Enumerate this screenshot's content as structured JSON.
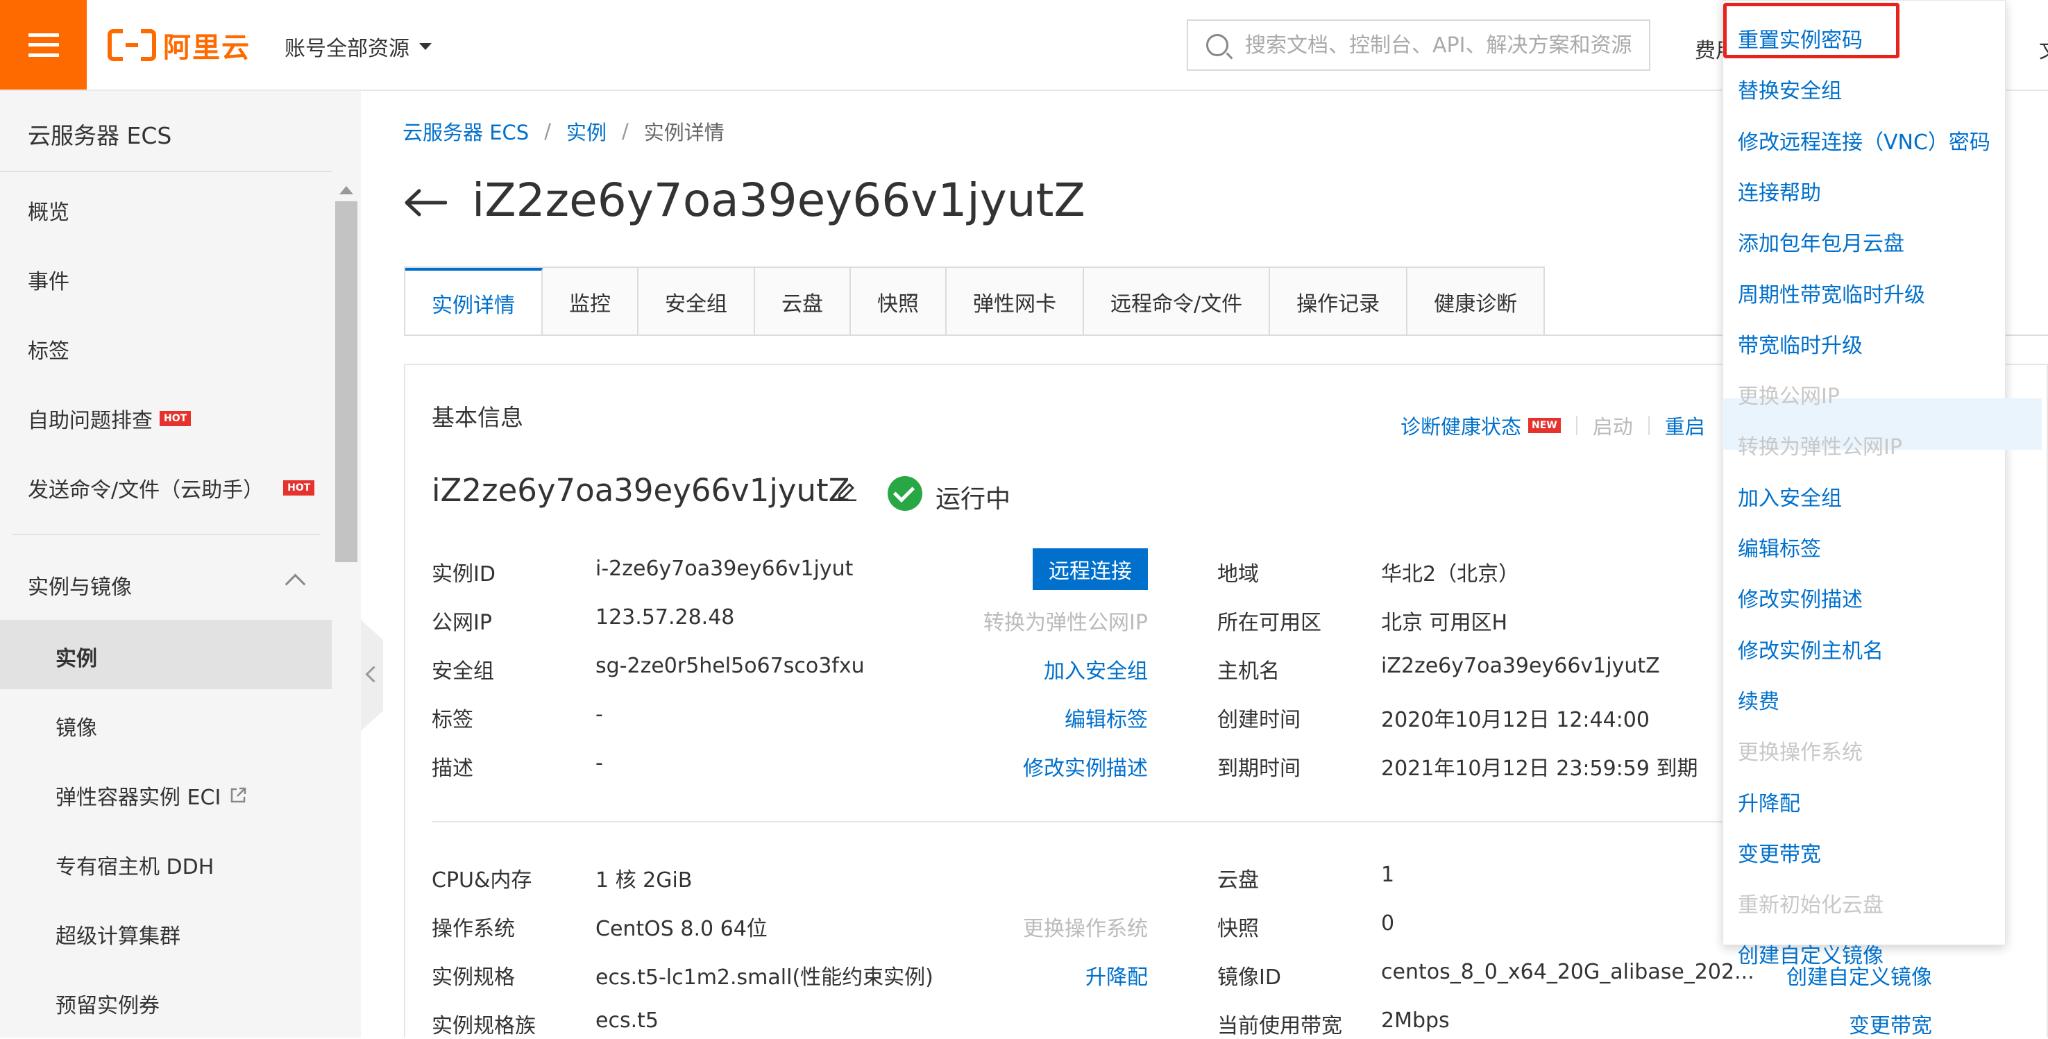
{
  "topbar": {
    "logo_text": "阿里云",
    "account_label": "账号全部资源",
    "search_placeholder": "搜索文档、控制台、API、解决方案和资源",
    "fee_label": "费用",
    "right_clip": "文"
  },
  "sidebar": {
    "title": "云服务器 ECS",
    "items": [
      {
        "label": "概览"
      },
      {
        "label": "事件"
      },
      {
        "label": "标签"
      },
      {
        "label": "自助问题排查",
        "badge": "HOT"
      },
      {
        "label": "发送命令/文件（云助手）",
        "badge": "HOT"
      }
    ],
    "group": {
      "label": "实例与镜像"
    },
    "sub_items": [
      {
        "label": "实例"
      },
      {
        "label": "镜像"
      },
      {
        "label": "弹性容器实例 ECI"
      },
      {
        "label": "专有宿主机 DDH"
      },
      {
        "label": "超级计算集群"
      },
      {
        "label": "预留实例券"
      }
    ]
  },
  "breadcrumb": {
    "items": [
      "云服务器 ECS",
      "实例",
      "实例详情"
    ],
    "sep": "/"
  },
  "page": {
    "title": "iZ2ze6y7oa39ey66v1jyutZ"
  },
  "tabs": [
    "实例详情",
    "监控",
    "安全组",
    "云盘",
    "快照",
    "弹性网卡",
    "远程命令/文件",
    "操作记录",
    "健康诊断"
  ],
  "panel": {
    "title": "基本信息",
    "actions": {
      "diagnose": "诊断健康状态",
      "new_badge": "NEW",
      "start": "启动",
      "restart": "重启"
    },
    "instance_name": "iZ2ze6y7oa39ey66v1jyutZ",
    "status": "运行中",
    "remote_button": "远程连接",
    "rows_left": [
      {
        "label": "实例ID",
        "value": "i-2ze6y7oa39ey66v1jyut",
        "action": ""
      },
      {
        "label": "公网IP",
        "value": "123.57.28.48",
        "action": "转换为弹性公网IP"
      },
      {
        "label": "安全组",
        "value": "sg-2ze0r5hel5o67sco3fxu",
        "action": "加入安全组"
      },
      {
        "label": "标签",
        "value": "-",
        "action": "编辑标签"
      },
      {
        "label": "描述",
        "value": "-",
        "action": "修改实例描述"
      }
    ],
    "rows_right": [
      {
        "label": "地域",
        "value": "华北2（北京）"
      },
      {
        "label": "所在可用区",
        "value": "北京 可用区H"
      },
      {
        "label": "主机名",
        "value": "iZ2ze6y7oa39ey66v1jyutZ"
      },
      {
        "label": "创建时间",
        "value": "2020年10月12日 12:44:00"
      },
      {
        "label": "到期时间",
        "value": "2021年10月12日 23:59:59 到期"
      }
    ],
    "spec_left": [
      {
        "label": "CPU&内存",
        "value": "1 核 2GiB",
        "action": ""
      },
      {
        "label": "操作系统",
        "value": "CentOS 8.0 64位",
        "action": "更换操作系统"
      },
      {
        "label": "实例规格",
        "value": "ecs.t5-lc1m2.small(性能约束实例)",
        "action": "升降配"
      },
      {
        "label": "实例规格族",
        "value": "ecs.t5",
        "action": ""
      }
    ],
    "spec_right": [
      {
        "label": "云盘",
        "value": "1",
        "action": ""
      },
      {
        "label": "快照",
        "value": "0",
        "action": ""
      },
      {
        "label": "镜像ID",
        "value": "centos_8_0_x64_20G_alibase_202...",
        "action": "创建自定义镜像"
      },
      {
        "label": "当前使用带宽",
        "value": "2Mbps",
        "action": "变更带宽"
      }
    ]
  },
  "menu": {
    "items": [
      {
        "label": "重置实例密码",
        "enabled": true
      },
      {
        "label": "替换安全组",
        "enabled": true
      },
      {
        "label": "修改远程连接（VNC）密码",
        "enabled": true
      },
      {
        "label": "连接帮助",
        "enabled": true
      },
      {
        "label": "添加包年包月云盘",
        "enabled": true
      },
      {
        "label": "周期性带宽临时升级",
        "enabled": true
      },
      {
        "label": "带宽临时升级",
        "enabled": true
      },
      {
        "label": "更换公网IP",
        "enabled": false
      },
      {
        "label": "转换为弹性公网IP",
        "enabled": false
      },
      {
        "label": "加入安全组",
        "enabled": true
      },
      {
        "label": "编辑标签",
        "enabled": true
      },
      {
        "label": "修改实例描述",
        "enabled": true
      },
      {
        "label": "修改实例主机名",
        "enabled": true
      },
      {
        "label": "续费",
        "enabled": true
      },
      {
        "label": "更换操作系统",
        "enabled": false
      },
      {
        "label": "升降配",
        "enabled": true
      },
      {
        "label": "变更带宽",
        "enabled": true
      },
      {
        "label": "重新初始化云盘",
        "enabled": false
      },
      {
        "label": "创建自定义镜像",
        "enabled": true
      }
    ]
  },
  "colors": {
    "brand": "#ff6a00",
    "link": "#0070cc",
    "highlight": "#e8231b",
    "running": "#28a745"
  }
}
